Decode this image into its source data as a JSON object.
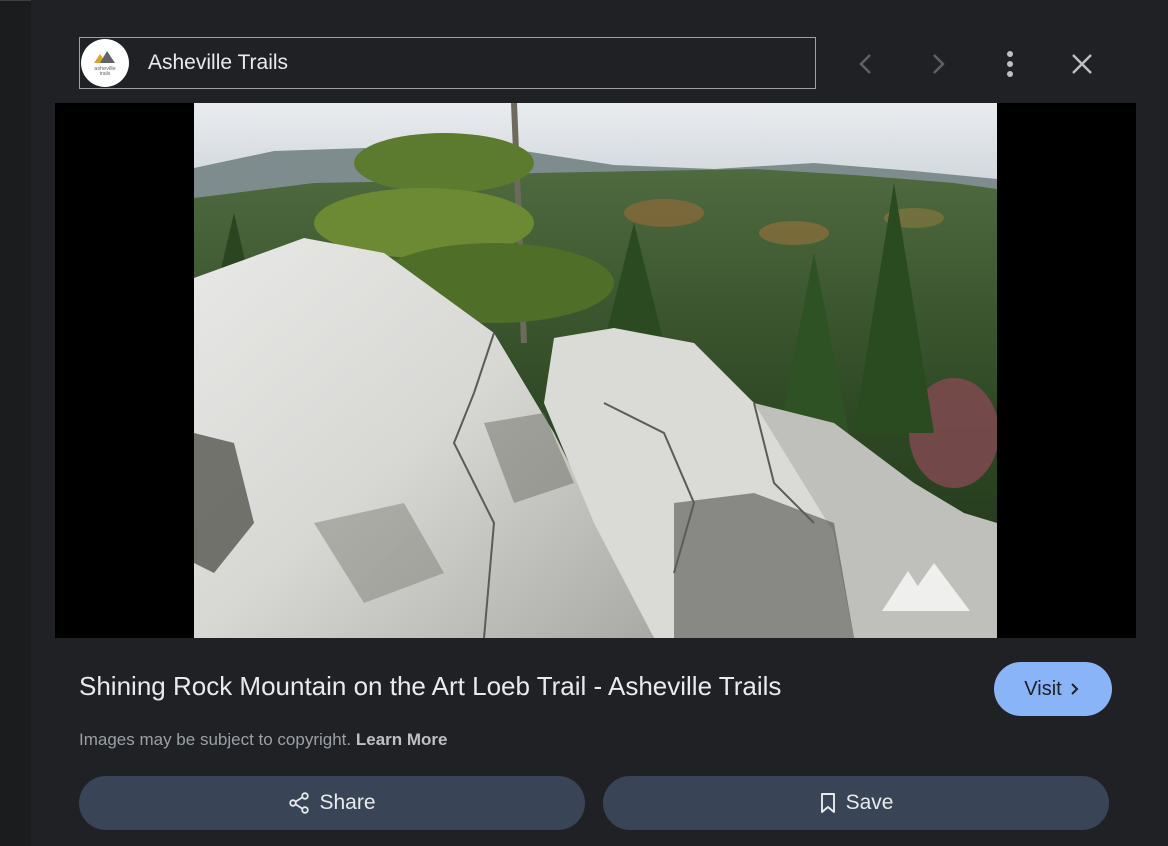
{
  "source": {
    "name": "Asheville Trails",
    "logo_text_line1": "asheville",
    "logo_text_line2": "trails"
  },
  "header_icons": {
    "prev": "chevron-left-icon",
    "next": "chevron-right-icon",
    "more": "more-vert-icon",
    "close": "close-icon"
  },
  "image": {
    "subject": "white quartzite rock outcrop with evergreen forest and mountains",
    "watermark_icon": "asheville-trails-mountain-icon"
  },
  "details": {
    "title": "Shining Rock Mountain on the Art Loeb Trail - Asheville Trails",
    "visit_label": "Visit",
    "copyright_text": "Images may be subject to copyright.",
    "learn_more_label": "Learn More"
  },
  "actions": {
    "share_label": "Share",
    "save_label": "Save"
  },
  "colors": {
    "background": "#202124",
    "visit_button": "#8ab4f8",
    "action_button": "#394457",
    "text_primary": "#e8eaed",
    "text_secondary": "#9aa0a6"
  }
}
